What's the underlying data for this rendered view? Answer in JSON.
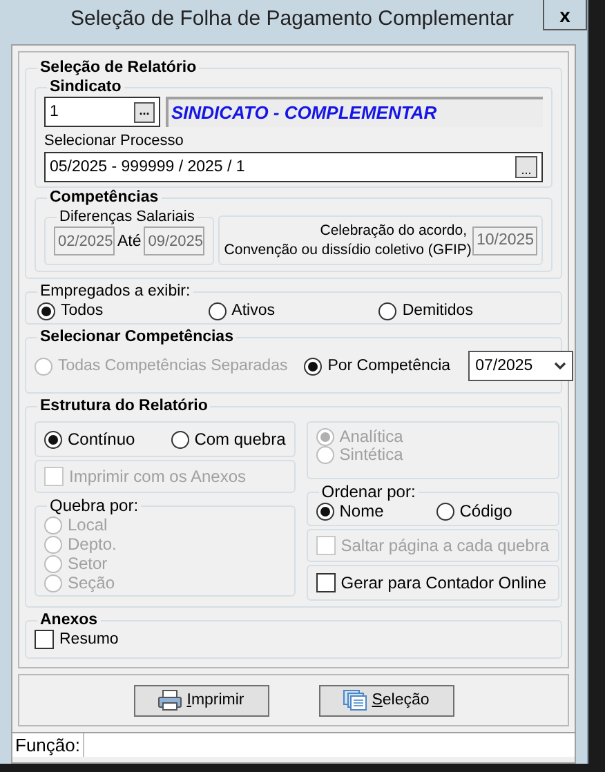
{
  "window": {
    "title": "Seleção de Folha de Pagamento Complementar",
    "close": "x"
  },
  "report_selection": {
    "title": "Seleção de Relatório",
    "sindicato": {
      "title": "Sindicato",
      "code": "1",
      "browse": "...",
      "name": "SINDICATO - COMPLEMENTAR"
    },
    "process": {
      "label": "Selecionar Processo",
      "value": "05/2025 - 999999 / 2025 / 1",
      "browse": "..."
    }
  },
  "competencias": {
    "title": "Competências",
    "differences": {
      "title": "Diferenças Salariais",
      "from": "02/2025",
      "to_label": "Até",
      "to": "09/2025",
      "disabled": true
    },
    "celebration": {
      "label_lines": [
        "Celebração do acordo,",
        "Convenção ou dissídio coletivo (GFIP)"
      ],
      "value": "10/2025",
      "disabled": true
    }
  },
  "employees": {
    "label": "Empregados a exibir:",
    "options": [
      {
        "label": "Todos",
        "selected": true
      },
      {
        "label": "Ativos",
        "selected": false
      },
      {
        "label": "Demitidos",
        "selected": false
      }
    ]
  },
  "select_competencias": {
    "title": "Selecionar Competências",
    "options": [
      {
        "label": "Todas Competências Separadas",
        "selected": false,
        "disabled": true
      },
      {
        "label": "Por Competência",
        "selected": true,
        "disabled": false
      }
    ],
    "dropdown": {
      "value": "07/2025"
    }
  },
  "structure": {
    "title": "Estrutura do Relatório",
    "layout_options": [
      {
        "label": "Contínuo",
        "selected": true
      },
      {
        "label": "Com quebra",
        "selected": false
      }
    ],
    "print_annexes": {
      "label": "Imprimir com os Anexos",
      "checked": false,
      "disabled": true
    },
    "break_by": {
      "label": "Quebra por:",
      "options": [
        {
          "label": "Local",
          "selected": false,
          "disabled": true
        },
        {
          "label": "Depto.",
          "selected": false,
          "disabled": true
        },
        {
          "label": "Setor",
          "selected": false,
          "disabled": true
        },
        {
          "label": "Seção",
          "selected": false,
          "disabled": true
        }
      ]
    },
    "detail_options": [
      {
        "label": "Analítica",
        "selected": true,
        "disabled": true
      },
      {
        "label": "Sintética",
        "selected": false,
        "disabled": true
      }
    ],
    "order_by": {
      "label": "Ordenar por:",
      "options": [
        {
          "label": "Nome",
          "selected": true
        },
        {
          "label": "Código",
          "selected": false
        }
      ]
    },
    "page_break": {
      "label": "Saltar página a cada quebra",
      "checked": false,
      "disabled": true
    },
    "contador_online": {
      "label": "Gerar para Contador Online",
      "checked": false,
      "disabled": false
    }
  },
  "annexes": {
    "title": "Anexos",
    "items": [
      {
        "label": "Resumo",
        "checked": false
      }
    ]
  },
  "buttons": [
    {
      "label": "Imprimir",
      "kind": "print"
    },
    {
      "label": "Seleção",
      "kind": "selection"
    }
  ],
  "status_bar": {
    "label": "Função:"
  }
}
